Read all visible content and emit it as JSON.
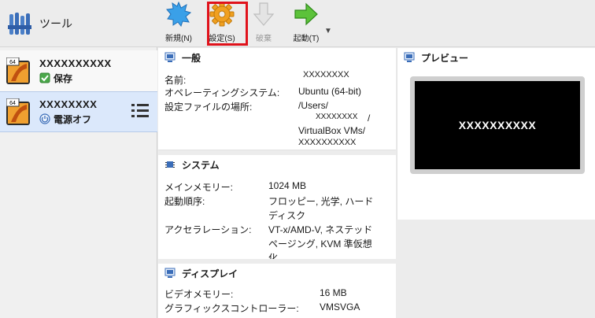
{
  "sidebar": {
    "tools_label": "ツール",
    "vms": [
      {
        "name": "XXXXXXXXXX",
        "status": "保存"
      },
      {
        "name": "XXXXXXXX",
        "status": "電源オフ"
      }
    ]
  },
  "toolbar": {
    "new_label": "新規(N)",
    "settings_label": "設定(S)",
    "discard_label": "破棄",
    "start_label": "起動(T)"
  },
  "general": {
    "title": "一般",
    "name_key": "名前:",
    "name_val": "XXXXXXXX",
    "os_key": "オペレーティングシステム:",
    "os_val": "Ubuntu (64-bit)",
    "loc_key": "設定ファイルの場所:",
    "loc_line1": "/Users/",
    "loc_line2": "XXXXXXXX",
    "loc_slash": "/",
    "loc_line3": "VirtualBox VMs/",
    "loc_line4": "XXXXXXXXXX"
  },
  "system": {
    "title": "システム",
    "mem_key": "メインメモリー:",
    "mem_val": "1024 MB",
    "boot_key": "起動順序:",
    "boot_val1": "フロッピー, 光学, ハード",
    "boot_val2": "ディスク",
    "accel_key": "アクセラレーション:",
    "accel_val1": "VT-x/AMD-V, ネステッド",
    "accel_val2": "ページング, KVM 準仮想",
    "accel_val3": "化"
  },
  "display": {
    "title": "ディスプレイ",
    "vmem_key": "ビデオメモリー:",
    "vmem_val": "16 MB",
    "gc_key": "グラフィックスコントローラー:",
    "gc_val": "VMSVGA"
  },
  "preview": {
    "title": "プレビュー",
    "screen_text": "XXXXXXXXXX"
  }
}
